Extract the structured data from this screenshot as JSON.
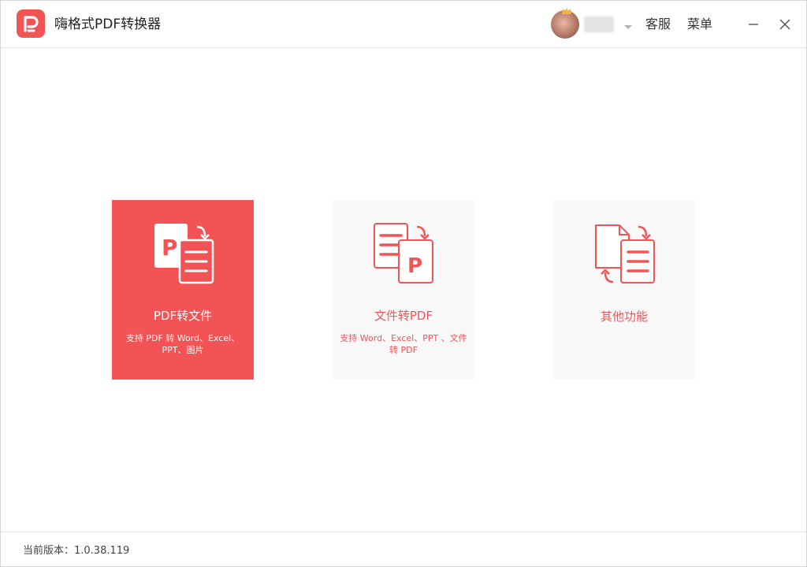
{
  "app": {
    "title": "嗨格式PDF转换器",
    "logo_letter": "P"
  },
  "header": {
    "service_label": "客服",
    "menu_label": "菜单",
    "minimize_glyph": "—",
    "close_glyph": "✕"
  },
  "cards": [
    {
      "title": "PDF转文件",
      "description": "支持 PDF 转 Word、Excel、PPT、图片",
      "icon": "pdf-to-file-icon",
      "selected": true
    },
    {
      "title": "文件转PDF",
      "description": "支持 Word、Excel、PPT 、文件转 PDF",
      "icon": "file-to-pdf-icon",
      "selected": false
    },
    {
      "title": "其他功能",
      "description": "",
      "icon": "other-functions-icon",
      "selected": false
    }
  ],
  "footer": {
    "version_text": "当前版本：1.0.38.119"
  },
  "colors": {
    "accent": "#f25456",
    "card_bg": "#f8f8f8",
    "text": "#333333"
  }
}
